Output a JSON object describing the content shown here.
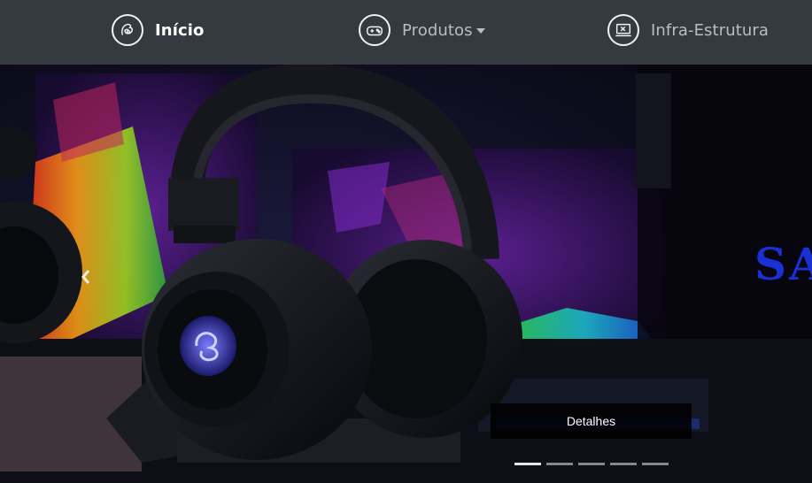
{
  "navbar": {
    "items": [
      {
        "label": "Início",
        "icon": "brand-logo-icon",
        "active": true
      },
      {
        "label": "Produtos",
        "icon": "gamepad-icon",
        "dropdown": true
      },
      {
        "label": "Infra-Estrutura",
        "icon": "laptop-tools-icon"
      }
    ]
  },
  "carousel": {
    "brand_text": "SA",
    "caption_label": "Detalhes",
    "indicator_count": 5,
    "active_indicator": 0,
    "prev_icon": "chevron-left-icon"
  },
  "colors": {
    "navbar_bg": "#343a40",
    "active_text": "#ffffff",
    "muted_text": "#b9bec4",
    "brand_blue": "#1a2fd4"
  }
}
